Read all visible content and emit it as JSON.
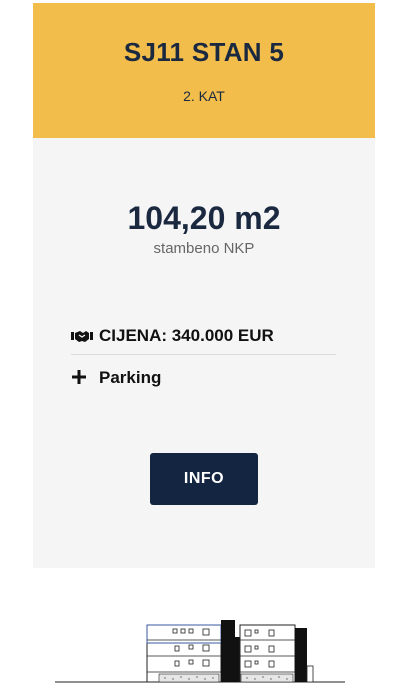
{
  "unit": {
    "title": "SJ11 STAN 5",
    "floor": "2. KAT"
  },
  "area": {
    "value": "104,20 m2",
    "type": "stambeno NKP"
  },
  "price": {
    "icon": "handshake-icon",
    "text": "CIJENA: 340.000 EUR"
  },
  "parking": {
    "icon": "plus-icon",
    "text": "Parking"
  },
  "info_button": {
    "label": "INFO"
  },
  "colors": {
    "header_bg": "#f2bd4a",
    "card_bg": "#f5f5f5",
    "button_bg": "#142541",
    "title_text": "#1b2940"
  }
}
